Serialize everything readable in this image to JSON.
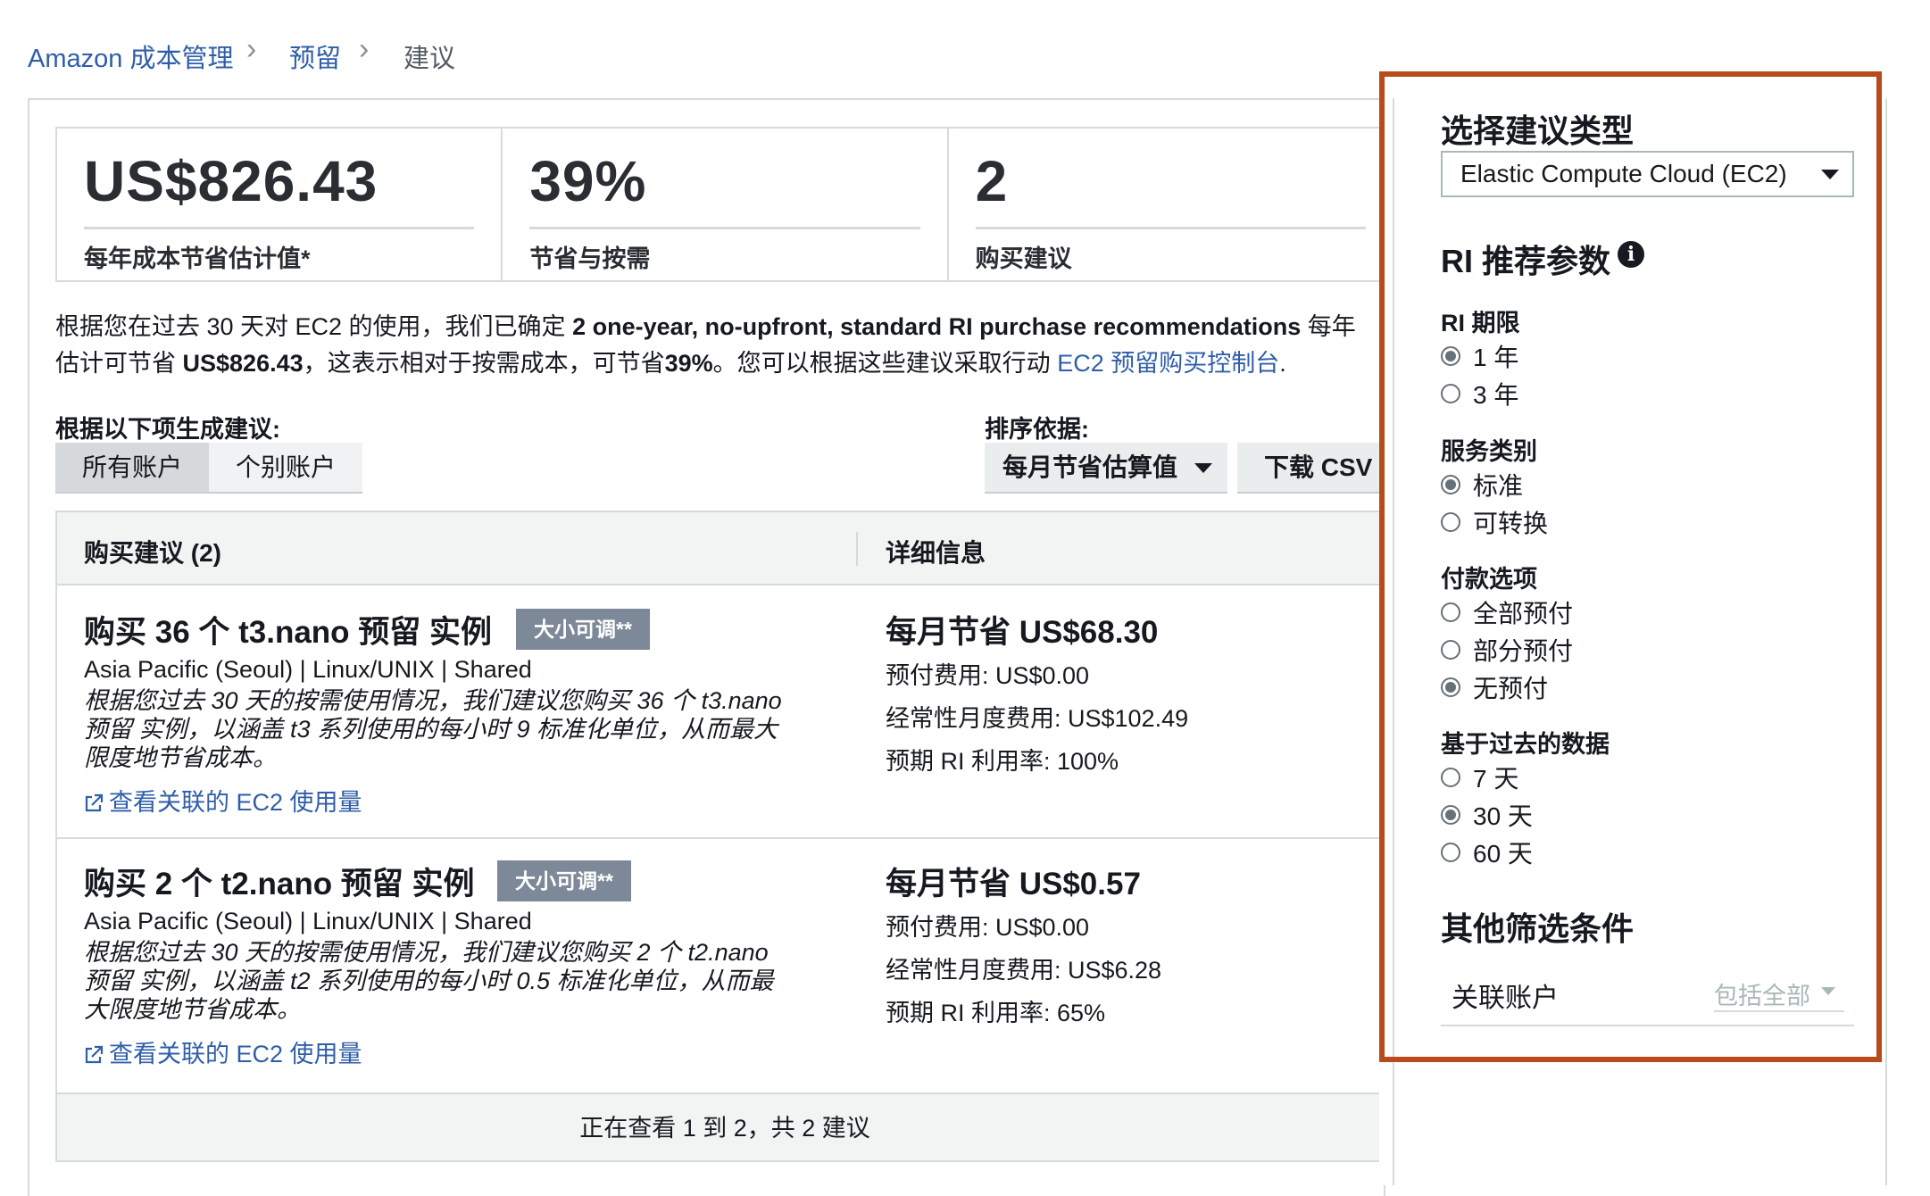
{
  "breadcrumb": {
    "items": [
      "Amazon 成本管理",
      "预留",
      "建议"
    ]
  },
  "summary": {
    "stats": [
      {
        "value": "US$826.43",
        "label": "每年成本节省估计值*"
      },
      {
        "value": "39%",
        "label": "节省与按需"
      },
      {
        "value": "2",
        "label": "购买建议"
      }
    ]
  },
  "description": {
    "line1_pre": "根据您在过去 30 天对 EC2 的使用，我们已确定 ",
    "line1_bold": "2 one-year, no-upfront, standard RI purchase recommendations",
    "line1_post": " 每年",
    "line2_pre": "估计可节省 ",
    "line2_amount": "US$826.43",
    "line2_mid": "，这表示相对于按需成本，可节省",
    "line2_pct": "39%",
    "line2_post": "。您可以根据这些建议采取行动 ",
    "line2_link": "EC2 预留购买控制台",
    "line2_end": "."
  },
  "generate": {
    "label": "根据以下项生成建议:",
    "options": [
      "所有账户",
      "个别账户"
    ],
    "selected": "所有账户"
  },
  "sort": {
    "label": "排序依据:",
    "value": "每月节省估算值",
    "download": "下载 CSV"
  },
  "table": {
    "header_left": "购买建议 (2)",
    "header_right": "详细信息",
    "rows": [
      {
        "title": "购买 36 个 t3.nano 预留 实例",
        "badge": "大小可调**",
        "sub": "Asia Pacific (Seoul) | Linux/UNIX | Shared",
        "note1": "根据您过去 30 天的按需使用情况，我们建议您购买 36 个 t3.nano",
        "note2": "预留 实例，以涵盖 t3 系列使用的每小时 9 标准化单位，从而最大",
        "note3": "限度地节省成本。",
        "link": "查看关联的 EC2 使用量",
        "saving": "每月节省 US$68.30",
        "upfront": "预付费用:  US$0.00",
        "recurring": "经常性月度费用:  US$102.49",
        "utilization": "预期 RI 利用率:  100%"
      },
      {
        "title": "购买 2 个 t2.nano 预留 实例",
        "badge": "大小可调**",
        "sub": "Asia Pacific (Seoul) | Linux/UNIX | Shared",
        "note1": "根据您过去 30 天的按需使用情况，我们建议您购买 2 个 t2.nano",
        "note2": "预留 实例，以涵盖 t2 系列使用的每小时 0.5 标准化单位，从而最",
        "note3": "大限度地节省成本。",
        "link": "查看关联的 EC2 使用量",
        "saving": "每月节省 US$0.57",
        "upfront": "预付费用:  US$0.00",
        "recurring": "经常性月度费用:  US$6.28",
        "utilization": "预期 RI 利用率:  65%"
      }
    ],
    "footer": "正在查看 1 到 2，共 2 建议"
  },
  "filters": {
    "type_heading": "选择建议类型",
    "type_value": "Elastic Compute Cloud (EC2)",
    "params_heading": "RI 推荐参数",
    "groups": [
      {
        "label": "RI 期限",
        "options": [
          "1 年",
          "3 年"
        ],
        "selected": 0
      },
      {
        "label": "服务类别",
        "options": [
          "标准",
          "可转换"
        ],
        "selected": 0
      },
      {
        "label": "付款选项",
        "options": [
          "全部预付",
          "部分预付",
          "无预付"
        ],
        "selected": 2
      },
      {
        "label": "基于过去的数据",
        "options": [
          "7 天",
          "30 天",
          "60 天"
        ],
        "selected": 1
      }
    ],
    "other_heading": "其他筛选条件",
    "linked_account_label": "关联账户",
    "linked_account_value": "包括全部"
  },
  "colors": {
    "link": "#2f5ea8",
    "highlight_border": "#b94a1b",
    "badge": "#7d8998"
  }
}
